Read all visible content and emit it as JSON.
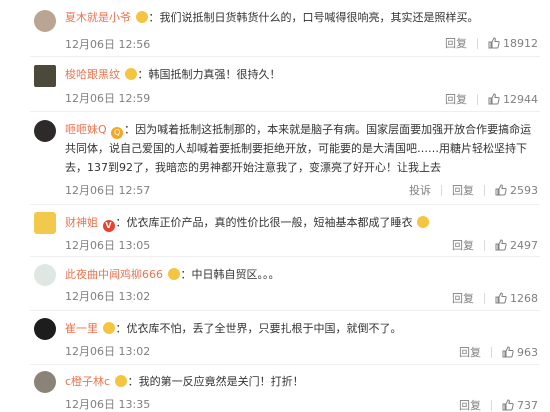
{
  "comments": [
    {
      "user": "夏木就是小爷",
      "sep": "：",
      "text": "我们说抵制日货韩货什么的，口号喊得很响亮，其实还是照样买。",
      "time": "12月06日 12:56",
      "reply": "回复",
      "likes": "18912",
      "avatar_color": "#b9a592",
      "emoji_after_name": true
    },
    {
      "user": "梭哈跟黑纹",
      "sep": "：",
      "text": "韩国抵制力真强！很持久！",
      "time": "12月06日 12:59",
      "reply": "回复",
      "likes": "12944",
      "avatar_color": "#4b4a3a",
      "emoji_after_name": true
    },
    {
      "user": "咂咂妹Q",
      "sep": "：",
      "text_lines": [
        "因为喊着抵制这抵制那的，本来就是脑子有病。国家层面要加强开放合作要搞命运",
        "共同体，说自己爱国的人却喊着要抵制要拒绝开放，可能要的是大清国吧……用糖片轻松坚持下",
        "去，137到92了，我暗恋的男神都开始注意我了，变漂亮了好开心！让我上去"
      ],
      "time": "12月06日 12:57",
      "report": "投诉",
      "reply": "回复",
      "likes": "2593",
      "avatar_color": "#2e2a2a",
      "badge_q": "Q"
    },
    {
      "user": "财神姐",
      "sep": "：",
      "text": "优衣库正价产品，真的性价比很一般，短袖基本都成了睡衣",
      "time": "12月06日 13:05",
      "reply": "回复",
      "likes": "2497",
      "avatar_color": "#f2c94c",
      "badge_v": "V"
    },
    {
      "user": "此夜曲中闻鸡柳666",
      "sep": "：",
      "text": "中日韩自贸区。。。",
      "time": "12月06日 13:02",
      "reply": "回复",
      "likes": "1268",
      "avatar_color": "#dfe7e3",
      "emoji_after_name": true
    },
    {
      "user": "崔一里",
      "sep": "：",
      "text": "优衣库不怕，丢了全世界，只要扎根于中国，就倒不了。",
      "time": "12月06日 13:02",
      "reply": "回复",
      "likes": "963",
      "avatar_color": "#1d1d1d",
      "emoji_after_name": true
    },
    {
      "user": "c橙子林c",
      "sep": "：",
      "text": "我的第一反应竟然是关门！打折！",
      "time": "12月06日 13:35",
      "reply": "回复",
      "likes": "737",
      "avatar_color": "#8b8378",
      "emoji_after_name": true
    }
  ],
  "colors": {
    "username": "#eb7350",
    "meta": "#808080",
    "text": "#333333"
  },
  "icons": [
    "avatar",
    "like-icon",
    "smiley-emoji-icon",
    "vip-badge",
    "q-badge"
  ]
}
